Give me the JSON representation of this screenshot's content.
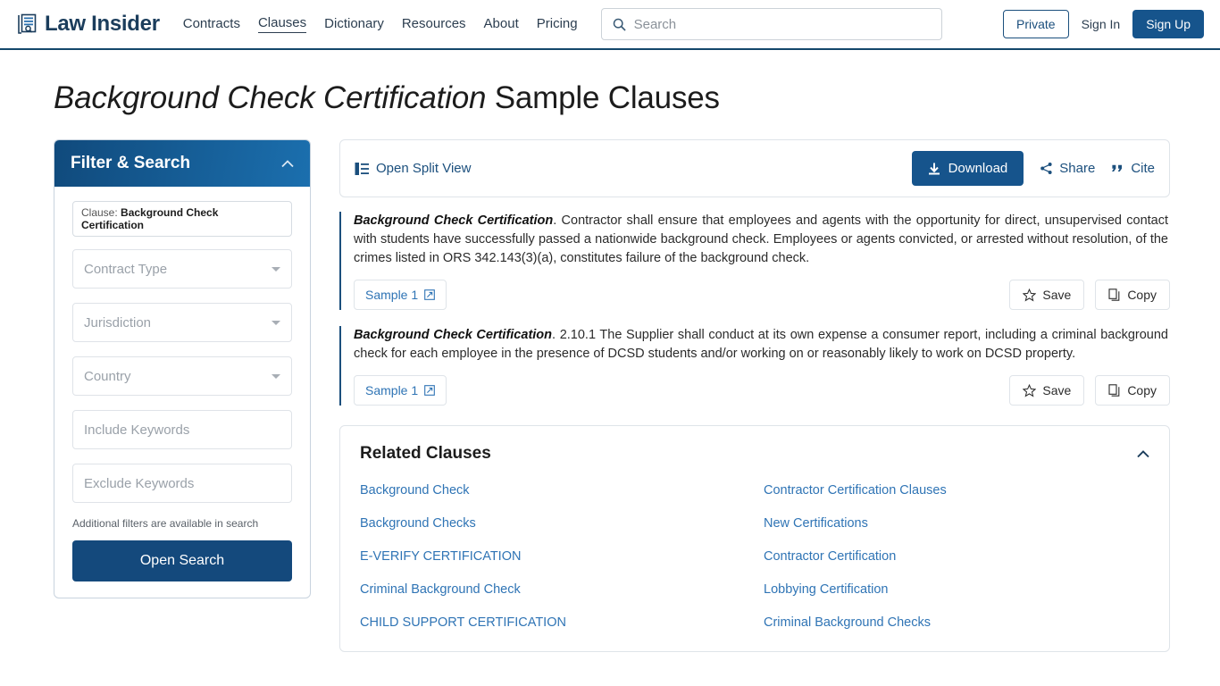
{
  "header": {
    "brand": "Law Insider",
    "logo_icon": "document-search-icon",
    "nav": [
      {
        "label": "Contracts",
        "active": false
      },
      {
        "label": "Clauses",
        "active": true
      },
      {
        "label": "Dictionary",
        "active": false
      },
      {
        "label": "Resources",
        "active": false
      },
      {
        "label": "About",
        "active": false
      },
      {
        "label": "Pricing",
        "active": false
      }
    ],
    "search": {
      "placeholder": "Search",
      "value": "",
      "icon": "search-icon"
    },
    "private_label": "Private",
    "signin_label": "Sign In",
    "signup_label": "Sign Up"
  },
  "page": {
    "title_emphasis": "Background Check Certification",
    "title_rest": " Sample Clauses"
  },
  "sidebar": {
    "title": "Filter & Search",
    "collapse_icon": "chevron-up-icon",
    "chip_prefix": "Clause:",
    "chip_value": "Background Check Certification",
    "fields": [
      {
        "label": "Contract Type",
        "type": "select"
      },
      {
        "label": "Jurisdiction",
        "type": "select"
      },
      {
        "label": "Country",
        "type": "select"
      },
      {
        "label": "Include Keywords",
        "type": "text"
      },
      {
        "label": "Exclude Keywords",
        "type": "text"
      }
    ],
    "hint": "Additional filters are available in search",
    "open_search_label": "Open Search"
  },
  "toolbar": {
    "split_view_label": "Open Split View",
    "split_view_icon": "split-view-icon",
    "download_label": "Download",
    "download_icon": "download-icon",
    "share_label": "Share",
    "share_icon": "share-icon",
    "cite_label": "Cite",
    "cite_icon": "quote-icon"
  },
  "clauses": [
    {
      "heading": "Background Check Certification",
      "text": ". Contractor shall ensure that employees and agents with the opportunity for direct, unsupervised contact with students have successfully passed a nationwide background check. Employees or agents convicted, or arrested without resolution, of the crimes listed in ORS 342.143(3)(a), constitutes failure of the background check.",
      "sample_label": "Sample 1",
      "sample_icon": "external-link-icon",
      "save_label": "Save",
      "save_icon": "star-icon",
      "copy_label": "Copy",
      "copy_icon": "copy-icon"
    },
    {
      "heading": "Background Check Certification",
      "text": ". 2.10.1 The Supplier shall conduct at its own expense a consumer report, including a criminal background check for each employee in the presence of DCSD students and/or working on or reasonably likely to work on DCSD property.",
      "sample_label": "Sample 1",
      "sample_icon": "external-link-icon",
      "save_label": "Save",
      "save_icon": "star-icon",
      "copy_label": "Copy",
      "copy_icon": "copy-icon"
    }
  ],
  "related": {
    "title": "Related Clauses",
    "collapse_icon": "chevron-up-icon",
    "links": [
      "Background Check",
      "Contractor Certification Clauses",
      "Background Checks",
      "New Certifications",
      "E-VERIFY CERTIFICATION",
      "Contractor Certification",
      "Criminal Background Check",
      "Lobbying Certification",
      "CHILD SUPPORT CERTIFICATION",
      "Criminal Background Checks"
    ]
  },
  "colors": {
    "brand_navy": "#1b3d5c",
    "primary_blue": "#16548c",
    "link_blue": "#2f74b5",
    "header_border": "#14476b"
  }
}
